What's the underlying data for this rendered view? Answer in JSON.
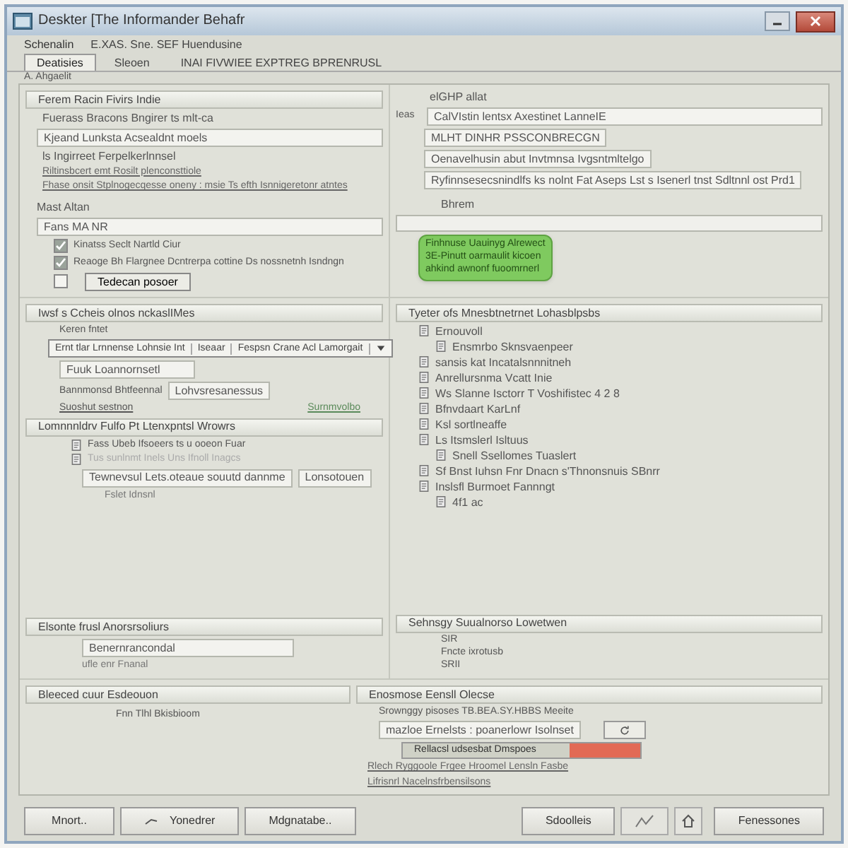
{
  "window": {
    "title": "Deskter [The Informander Behafr"
  },
  "toolbar": {
    "label": "Schenalin",
    "text": "E.XAS. Sne. SEF Huendusine"
  },
  "tabs": [
    {
      "label": "Deatisies",
      "selected": true
    },
    {
      "label": "Sleoen",
      "selected": false
    },
    {
      "label": "INAI FIVWIEE EXPTREG BPRENRUSL",
      "selected": false
    }
  ],
  "group_label": "A. Ahgaelit",
  "options_panel": {
    "title": "Ferem Racin Fivirs Indie",
    "rows": [
      {
        "kind": "text",
        "text": "Fuerass Bracons Bngirer ts mlt-ca"
      },
      {
        "kind": "field",
        "value": "Kjeand Lunksta Acsealdnt moels"
      },
      {
        "kind": "text",
        "text": "ls Ingirreet Ferpelkerlnnsel"
      },
      {
        "kind": "link",
        "text": "Riltinsbcert emt Rosilt plenconsttiole"
      },
      {
        "kind": "link",
        "text": "Fhase onsit Stplnogecqesse oneny : msie Ts efth Isnnigeretonr atntes"
      }
    ],
    "section_label": "Mast Altan",
    "dropdown": "Fans MA NR",
    "checks": [
      {
        "label": "Kinatss Seclt Nartld Ciur",
        "checked": true
      },
      {
        "label": "Reaoge Bh Flargnee Dcntrerpa cottine Ds nossnetnh Isndngn",
        "checked": true
      },
      {
        "checked": false
      }
    ],
    "button": "Tedecan posoer"
  },
  "details_panel": {
    "title": "elGHP allat",
    "side_label": "Ieas",
    "fields": [
      "CalVIstin lentsx Axestinet LanneIE",
      "MLHT DINHR PSSCONBRECGN",
      "Oenavelhusin abut Invtmnsa Ivgsntmltelgo",
      "Ryfinnsesecsnindlfs ks nolnt Fat Aseps Lst s Isenerl tnst Sdltnnl ost Prd1"
    ],
    "notes_label": "Bhrem"
  },
  "popup": {
    "lines": [
      "Finhnuse Uauinyg Alrewect",
      "3E-Pinutt oarmaulit kicoen",
      "ahkind awnonf fuoomrnerl"
    ]
  },
  "settings_panel": {
    "title": "Iwsf s Ccheis olnos nckaslIMes",
    "label": "Keren fntet",
    "dropdown": [
      "Ernt tlar Lrnnense Lohnsie Int",
      "Iseaar",
      "Fespsn Crane Acl Lamorgait"
    ],
    "field": "Fuuk Loannornsetl",
    "row_label": "Bannmonsd Bhtfeennal",
    "row_field": "Lohvsresanessus",
    "note": "Suoshut sestnon",
    "link": "Surnmvolbo"
  },
  "list_panel": {
    "title": "Lomnnnldrv Fulfo Pt Ltenxpntsl Wrowrs",
    "items": [
      {
        "label": "Fass Ubeb Ifsoeers ts u ooeon Fuar",
        "disabled": false
      },
      {
        "label": "Tus sunlnmt Inels Uns Ifnoll Inagcs",
        "disabled": true
      }
    ],
    "field": "Tewnevsul Lets.oteaue souutd dannme",
    "side_field": "Lonsotouen",
    "option": "Fslet Idnsnl"
  },
  "export_panel": {
    "title": "Elsonte frusl Anorsrsoliurs",
    "field": "Benernrancondal",
    "note": "ufle enr Fnanal"
  },
  "tree": {
    "title": "Tyeter ofs Mnesbtnetrnet Lohasblpsbs",
    "items": [
      {
        "label": "Ernouvoll",
        "children": [
          {
            "label": "Ensmrbo Sknsvaenpeer"
          }
        ]
      },
      {
        "label": "sansis kat Incatalsnnnitneh"
      },
      {
        "label": "Anrellursnma Vcatt Inie"
      },
      {
        "label": "Ws Slanne Isctorr T Voshifistec 4 2 8"
      },
      {
        "label": "Bfnvdaart KarLnf"
      },
      {
        "label": "Ksl sortlneaffe"
      },
      {
        "label": "Ls Itsmslerl Isltuus",
        "children": [
          {
            "label": "Snell Ssellomes Tuaslert"
          }
        ]
      },
      {
        "label": "Sf Bnst Iuhsn Fnr Dnacn s'Thnonsnuis SBnrr"
      },
      {
        "label": "Inslsfl Burmoet Fannngt",
        "children": [
          {
            "label": "4f1 ac"
          }
        ]
      }
    ]
  },
  "summary": {
    "title": "Sehnsgy Suualnorso Lowetwen",
    "items": [
      "SIR",
      "Fncte ixrotusb",
      "SRII"
    ]
  },
  "bottom_left": {
    "title": "Bleeced cuur Esdeouon",
    "text": "Fnn Tlhl Bkisbioom"
  },
  "bottom_right": {
    "title": "Enosmose Eensll Olecse",
    "text": "Srownggy pisoses TB.BEA.SY.HBBS Meeite",
    "field": "mazloe Ernelsts : poanerlowr Isolnset",
    "progress": {
      "label": "Rellacsl udsesbat Dmspoes",
      "level": 0.3
    },
    "lines": [
      "Rlech Ryggoole Frgee Hroomel Lensln Fasbe",
      "Lifrisnrl Nacelnsfrbensilsons"
    ]
  },
  "buttons": [
    {
      "label": "Mnort..",
      "kind": "plain"
    },
    {
      "label": "Yonedrer",
      "kind": "icon"
    },
    {
      "label": "Mdgnatabe..",
      "kind": "plain"
    },
    {
      "label": "Sdoolleis",
      "kind": "plain"
    },
    {
      "label": "Fenessones",
      "kind": "tools"
    }
  ]
}
